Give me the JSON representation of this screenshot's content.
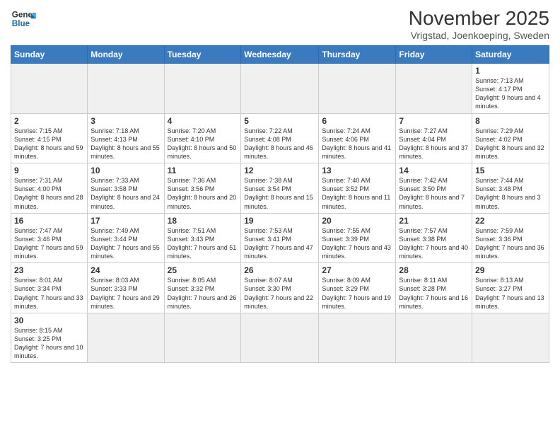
{
  "header": {
    "logo_general": "General",
    "logo_blue": "Blue",
    "month_title": "November 2025",
    "subtitle": "Vrigstad, Joenkoeping, Sweden"
  },
  "weekdays": [
    "Sunday",
    "Monday",
    "Tuesday",
    "Wednesday",
    "Thursday",
    "Friday",
    "Saturday"
  ],
  "weeks": [
    [
      {
        "day": "",
        "empty": true
      },
      {
        "day": "",
        "empty": true
      },
      {
        "day": "",
        "empty": true
      },
      {
        "day": "",
        "empty": true
      },
      {
        "day": "",
        "empty": true
      },
      {
        "day": "",
        "empty": true
      },
      {
        "day": "1",
        "sunrise": "7:13 AM",
        "sunset": "4:17 PM",
        "daylight": "9 hours and 4 minutes."
      }
    ],
    [
      {
        "day": "2",
        "sunrise": "7:15 AM",
        "sunset": "4:15 PM",
        "daylight": "8 hours and 59 minutes."
      },
      {
        "day": "3",
        "sunrise": "7:18 AM",
        "sunset": "4:13 PM",
        "daylight": "8 hours and 55 minutes."
      },
      {
        "day": "4",
        "sunrise": "7:20 AM",
        "sunset": "4:10 PM",
        "daylight": "8 hours and 50 minutes."
      },
      {
        "day": "5",
        "sunrise": "7:22 AM",
        "sunset": "4:08 PM",
        "daylight": "8 hours and 46 minutes."
      },
      {
        "day": "6",
        "sunrise": "7:24 AM",
        "sunset": "4:06 PM",
        "daylight": "8 hours and 41 minutes."
      },
      {
        "day": "7",
        "sunrise": "7:27 AM",
        "sunset": "4:04 PM",
        "daylight": "8 hours and 37 minutes."
      },
      {
        "day": "8",
        "sunrise": "7:29 AM",
        "sunset": "4:02 PM",
        "daylight": "8 hours and 32 minutes."
      }
    ],
    [
      {
        "day": "9",
        "sunrise": "7:31 AM",
        "sunset": "4:00 PM",
        "daylight": "8 hours and 28 minutes."
      },
      {
        "day": "10",
        "sunrise": "7:33 AM",
        "sunset": "3:58 PM",
        "daylight": "8 hours and 24 minutes."
      },
      {
        "day": "11",
        "sunrise": "7:36 AM",
        "sunset": "3:56 PM",
        "daylight": "8 hours and 20 minutes."
      },
      {
        "day": "12",
        "sunrise": "7:38 AM",
        "sunset": "3:54 PM",
        "daylight": "8 hours and 15 minutes."
      },
      {
        "day": "13",
        "sunrise": "7:40 AM",
        "sunset": "3:52 PM",
        "daylight": "8 hours and 11 minutes."
      },
      {
        "day": "14",
        "sunrise": "7:42 AM",
        "sunset": "3:50 PM",
        "daylight": "8 hours and 7 minutes."
      },
      {
        "day": "15",
        "sunrise": "7:44 AM",
        "sunset": "3:48 PM",
        "daylight": "8 hours and 3 minutes."
      }
    ],
    [
      {
        "day": "16",
        "sunrise": "7:47 AM",
        "sunset": "3:46 PM",
        "daylight": "7 hours and 59 minutes."
      },
      {
        "day": "17",
        "sunrise": "7:49 AM",
        "sunset": "3:44 PM",
        "daylight": "7 hours and 55 minutes."
      },
      {
        "day": "18",
        "sunrise": "7:51 AM",
        "sunset": "3:43 PM",
        "daylight": "7 hours and 51 minutes."
      },
      {
        "day": "19",
        "sunrise": "7:53 AM",
        "sunset": "3:41 PM",
        "daylight": "7 hours and 47 minutes."
      },
      {
        "day": "20",
        "sunrise": "7:55 AM",
        "sunset": "3:39 PM",
        "daylight": "7 hours and 43 minutes."
      },
      {
        "day": "21",
        "sunrise": "7:57 AM",
        "sunset": "3:38 PM",
        "daylight": "7 hours and 40 minutes."
      },
      {
        "day": "22",
        "sunrise": "7:59 AM",
        "sunset": "3:36 PM",
        "daylight": "7 hours and 36 minutes."
      }
    ],
    [
      {
        "day": "23",
        "sunrise": "8:01 AM",
        "sunset": "3:34 PM",
        "daylight": "7 hours and 33 minutes."
      },
      {
        "day": "24",
        "sunrise": "8:03 AM",
        "sunset": "3:33 PM",
        "daylight": "7 hours and 29 minutes."
      },
      {
        "day": "25",
        "sunrise": "8:05 AM",
        "sunset": "3:32 PM",
        "daylight": "7 hours and 26 minutes."
      },
      {
        "day": "26",
        "sunrise": "8:07 AM",
        "sunset": "3:30 PM",
        "daylight": "7 hours and 22 minutes."
      },
      {
        "day": "27",
        "sunrise": "8:09 AM",
        "sunset": "3:29 PM",
        "daylight": "7 hours and 19 minutes."
      },
      {
        "day": "28",
        "sunrise": "8:11 AM",
        "sunset": "3:28 PM",
        "daylight": "7 hours and 16 minutes."
      },
      {
        "day": "29",
        "sunrise": "8:13 AM",
        "sunset": "3:27 PM",
        "daylight": "7 hours and 13 minutes."
      }
    ],
    [
      {
        "day": "30",
        "sunrise": "8:15 AM",
        "sunset": "3:25 PM",
        "daylight": "7 hours and 10 minutes.",
        "last": true
      },
      {
        "day": "",
        "empty": true,
        "last": true
      },
      {
        "day": "",
        "empty": true,
        "last": true
      },
      {
        "day": "",
        "empty": true,
        "last": true
      },
      {
        "day": "",
        "empty": true,
        "last": true
      },
      {
        "day": "",
        "empty": true,
        "last": true
      },
      {
        "day": "",
        "empty": true,
        "last": true
      }
    ]
  ]
}
